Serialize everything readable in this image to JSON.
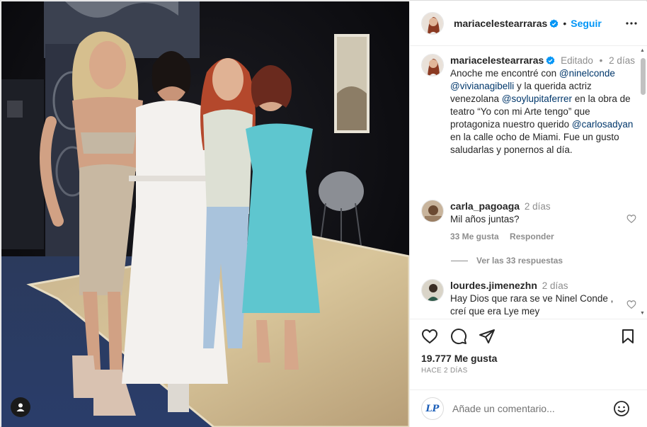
{
  "post": {
    "image_alt": "",
    "tag_icon": "user-tag-icon"
  },
  "header": {
    "username": "mariacelestearraras",
    "separator": "•",
    "follow_label": "Seguir",
    "more_icon": "more-horizontal-icon"
  },
  "caption": {
    "username": "mariacelestearraras",
    "edited": "Editado",
    "separator": "•",
    "time": "2 días",
    "text": {
      "p1": "Anoche me encontré con ",
      "m1": "@ninelconde",
      "p2": " ",
      "m2": "@vivianagibelli",
      "p3": " y la querida actriz venezolana ",
      "m3": "@soylupitaferrer",
      "p4": " en la obra de teatro “Yo con mi Arte tengo” que protagoniza nuestro querido ",
      "m4": "@carlosadyan",
      "p5": " en la calle ocho de Miami. Fue un gusto saludarlas y ponernos al día."
    }
  },
  "comments": [
    {
      "username": "carla_pagoaga",
      "time": "2 días",
      "text": "Mil años juntas?",
      "likes": "33 Me gusta",
      "reply": "Responder",
      "view_replies": "Ver las 33 respuestas"
    },
    {
      "username": "lourdes.jimenezhn",
      "time": "2 días",
      "text": "Hay Dios que rara se ve Ninel Conde , creí que era Lye mey"
    }
  ],
  "actions": {
    "likes": "19.777 Me gusta",
    "ago": "HACE 2 DÍAS"
  },
  "add_comment": {
    "placeholder": "Añade un comentario...",
    "avatar_text": "LP"
  },
  "colors": {
    "link": "#00376b",
    "follow": "#0095f6",
    "verified": "#0095f6",
    "muted": "#8e8e8e"
  }
}
